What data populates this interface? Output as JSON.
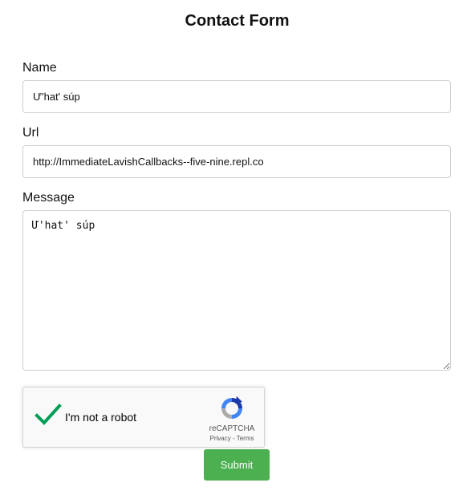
{
  "page": {
    "title": "Contact Form"
  },
  "form": {
    "name_label": "Name",
    "name_value": "Ư'hat' súp",
    "url_label": "Url",
    "url_value": "http://ImmediateLavishCallbacks--five-nine.repl.co",
    "message_label": "Message",
    "message_value": "Ư'hat' súp",
    "submit_label": "Submit"
  },
  "recaptcha": {
    "label": "I'm not a robot",
    "brand": "reCAPTCHA",
    "privacy": "Privacy",
    "separator": "-",
    "terms": "Terms",
    "checked": true,
    "check_color": "#009e55",
    "check_icon": "checkmark-icon",
    "logo_icon": "recaptcha-logo-icon"
  },
  "colors": {
    "submit_bg": "#4caf50",
    "border": "#cfcfcf"
  }
}
